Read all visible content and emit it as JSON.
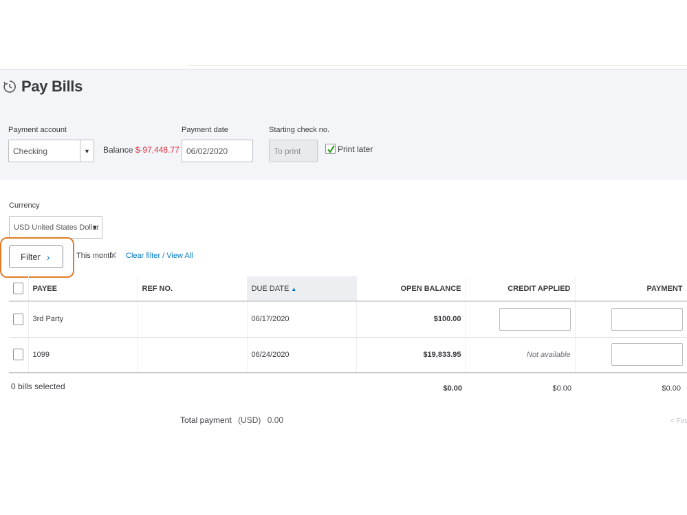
{
  "page": {
    "title": "Pay Bills",
    "title_icon": "pay-bills-clock-icon"
  },
  "payment": {
    "account_label": "Payment account",
    "account_value": "Checking",
    "balance_label": "Balance",
    "balance_value": "$-97,448.77",
    "date_label": "Payment date",
    "date_value": "06/02/2020",
    "check_label": "Starting check no.",
    "check_placeholder": "To print",
    "print_later_label": "Print later",
    "print_later_checked": true
  },
  "currency": {
    "label": "Currency",
    "value": "USD United States Dollar"
  },
  "filter": {
    "button_label": "Filter",
    "chevron": "›",
    "active_filter": "This month",
    "clear_icon": "✕",
    "clear_link": "Clear filter / View All"
  },
  "table": {
    "columns": {
      "payee": "PAYEE",
      "ref": "REF NO.",
      "due": "DUE DATE",
      "sort_arrow": "▲",
      "open": "OPEN BALANCE",
      "credit": "CREDIT APPLIED",
      "payment": "PAYMENT"
    },
    "rows": [
      {
        "payee": "3rd Party",
        "ref": "",
        "due": "06/17/2020",
        "open": "$100.00",
        "credit": ""
      },
      {
        "payee": "1099",
        "ref": "",
        "due": "06/24/2020",
        "open": "$19,833.95",
        "credit": "Not available"
      }
    ]
  },
  "footer": {
    "selected": "0 bills selected",
    "open_total": "$0.00",
    "credit_total": "$0.00",
    "payment_total": "$0.00",
    "total_payment_label": "Total payment",
    "total_payment_currency": "(USD)",
    "total_payment_value": "0.00",
    "pager": "< First"
  },
  "colors": {
    "accent": "#0077c5",
    "balance_negative": "#e0313a",
    "highlight": "#e07b27",
    "check_green": "#2ca01c"
  }
}
